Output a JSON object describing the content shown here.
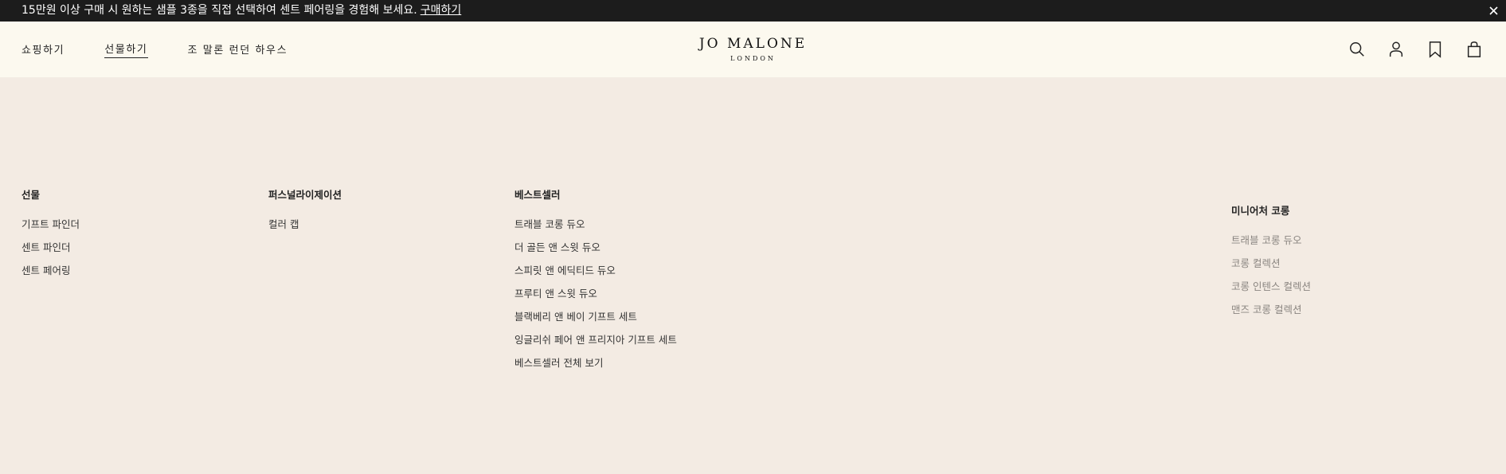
{
  "promo": {
    "text": "15만원 이상 구매 시 원하는 샘플 3종을 직접 선택하여 센트 페어링을 경험해 보세요.",
    "link": "구매하기",
    "close": "✕"
  },
  "nav": {
    "items": [
      {
        "label": "쇼핑하기",
        "active": false
      },
      {
        "label": "선물하기",
        "active": true
      },
      {
        "label": "조 말론 런던 하우스",
        "active": false
      }
    ]
  },
  "logo": {
    "line1": "JO MALONE",
    "line2": "LONDON"
  },
  "icons": [
    "search-icon",
    "account-icon",
    "bookmark-icon",
    "bag-icon"
  ],
  "menu": {
    "columns": [
      {
        "title": "선물",
        "items": [
          "기프트 파인더",
          "센트 파인더",
          "센트 페어링"
        ]
      },
      {
        "title": "퍼스널라이제이션",
        "items": [
          "컬러 캡"
        ]
      },
      {
        "title": "베스트셀러",
        "items": [
          "트래블 코롱 듀오",
          "더 골든 앤 스윗 듀오",
          "스피릿 앤 에딕티드 듀오",
          "프루티 앤 스윗 듀오",
          "블랙베리 앤 베이 기프트 세트",
          "잉글리쉬 페어 앤 프리지아 기프트 세트",
          "베스트셀러 전체 보기"
        ]
      },
      {
        "title": "미니어처 코롱",
        "items": [
          "트래블 코롱 듀오",
          "코롱 컬렉션",
          "코롱 인텐스 컬렉션",
          "맨즈 코롱 컬렉션"
        ]
      }
    ]
  }
}
